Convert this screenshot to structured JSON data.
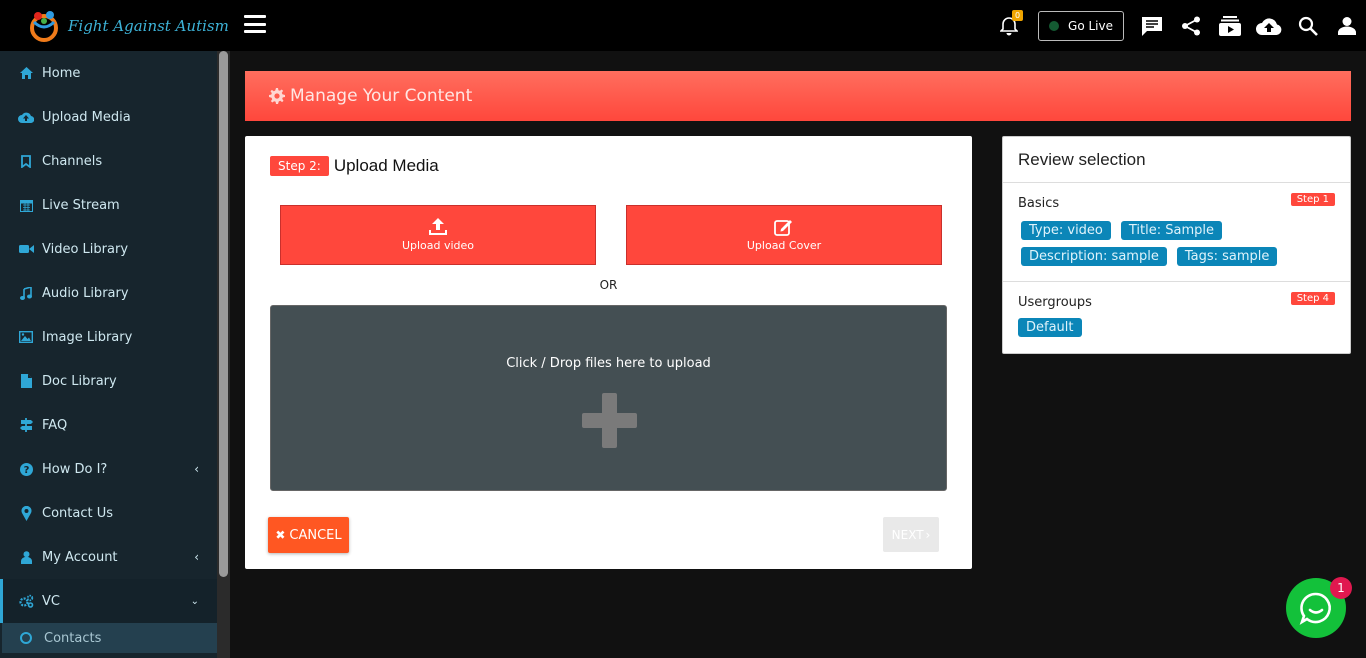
{
  "brand": {
    "name": "Fight Against Autism"
  },
  "sidebar": {
    "items": [
      {
        "label": "Home",
        "icon": "home-icon"
      },
      {
        "label": "Upload Media",
        "icon": "cloud-upload-icon"
      },
      {
        "label": "Channels",
        "icon": "bookmark-icon"
      },
      {
        "label": "Live Stream",
        "icon": "calendar-icon"
      },
      {
        "label": "Video Library",
        "icon": "video-camera-icon"
      },
      {
        "label": "Audio Library",
        "icon": "music-note-icon"
      },
      {
        "label": "Image Library",
        "icon": "image-icon"
      },
      {
        "label": "Doc Library",
        "icon": "document-icon"
      },
      {
        "label": "FAQ",
        "icon": "signpost-icon"
      },
      {
        "label": "How Do I?",
        "icon": "question-circle-icon"
      },
      {
        "label": "Contact Us",
        "icon": "map-marker-icon"
      },
      {
        "label": "My Account",
        "icon": "user-icon"
      },
      {
        "label": "VC",
        "icon": "cogs-icon"
      }
    ],
    "sub_item": {
      "label": "Contacts"
    }
  },
  "topbar": {
    "notification_count": "0",
    "go_live_label": "Go Live"
  },
  "banner": {
    "title": "Manage Your Content"
  },
  "upload": {
    "step_badge": "Step 2:",
    "step_title": "Upload Media",
    "upload_video_label": "Upload video",
    "upload_cover_label": "Upload Cover",
    "or_label": "OR",
    "dropzone_text": "Click / Drop files here to upload",
    "cancel_label": "CANCEL",
    "next_label": "NEXT"
  },
  "review": {
    "title": "Review selection",
    "basics": {
      "title": "Basics",
      "step": "Step 1",
      "tags": [
        "Type: video",
        "Title: Sample",
        "Description: sample",
        "Tags: sample"
      ]
    },
    "usergroups": {
      "title": "Usergroups",
      "step": "Step 4",
      "tags": [
        "Default"
      ]
    }
  },
  "chat": {
    "badge": "1"
  },
  "colors": {
    "accent": "#ff473c",
    "tag_blue": "#0b86b8",
    "sidebar_bg": "#17252d",
    "chat_green": "#13c13a"
  }
}
